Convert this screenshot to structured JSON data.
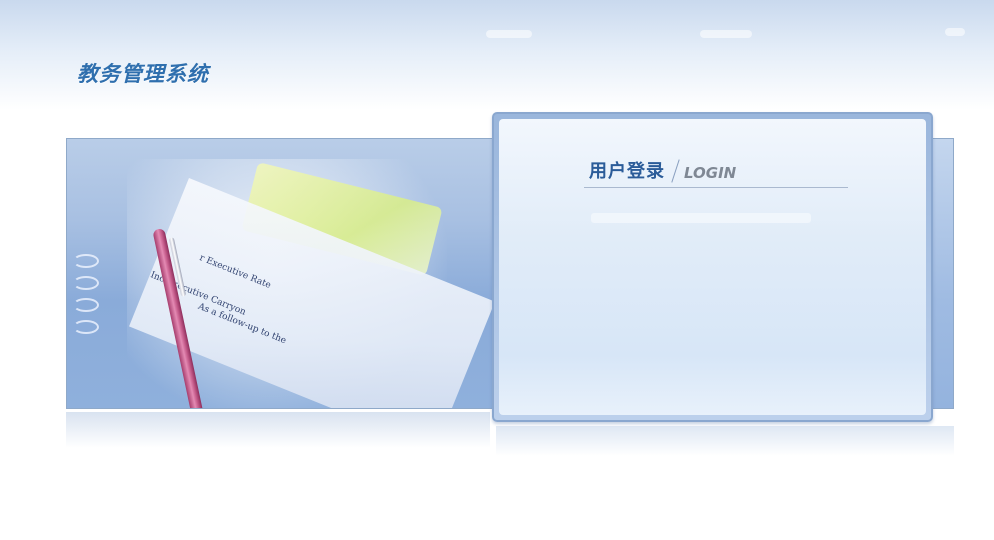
{
  "header": {
    "app_title": "教务管理系统"
  },
  "photo": {
    "lines": [
      "r Executive Rate",
      "Inc  Executive Carryon",
      "As a follow-up to the"
    ]
  },
  "login": {
    "title": "用户登录",
    "subtitle": "LOGIN"
  },
  "colors": {
    "title_blue": "#2f6fae",
    "login_title": "#2b5c99",
    "login_subtitle": "#7f8894",
    "panel_blue": "#8aabd9"
  }
}
